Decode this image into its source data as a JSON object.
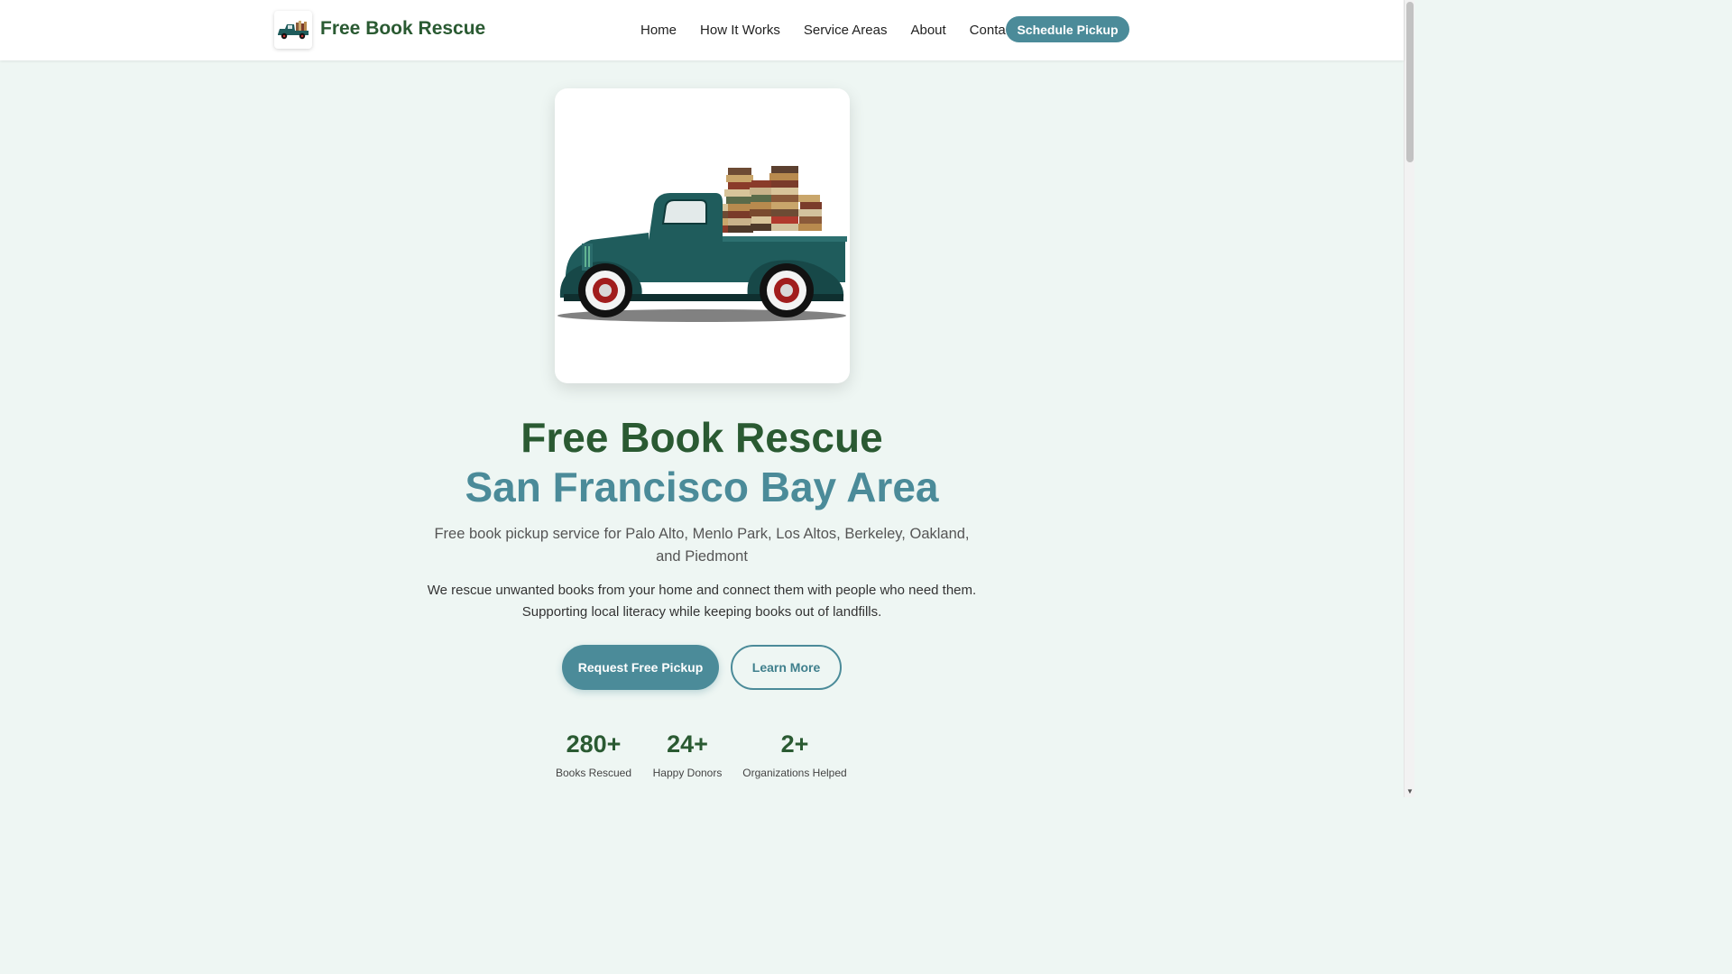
{
  "header": {
    "brand": "Free Book Rescue",
    "logo_icon": "truck-with-books-icon",
    "nav": [
      {
        "label": "Home"
      },
      {
        "label": "How It Works"
      },
      {
        "label": "Service Areas"
      },
      {
        "label": "About"
      },
      {
        "label": "Contact"
      }
    ],
    "cta_label": "Schedule Pickup"
  },
  "hero": {
    "image_icon": "vintage-truck-with-books-image",
    "title": "Free Book Rescue",
    "subtitle": "San Francisco Bay Area",
    "tagline": "Free book pickup service for Palo Alto, Menlo Park, Los Altos, Berkeley, Oakland, and Piedmont",
    "description": "We rescue unwanted books from your home and connect them with people who need them. Supporting local literacy while keeping books out of landfills.",
    "primary_button": "Request Free Pickup",
    "secondary_button": "Learn More"
  },
  "stats": [
    {
      "value": "280+",
      "label": "Books Rescued"
    },
    {
      "value": "24+",
      "label": "Happy Donors"
    },
    {
      "value": "2+",
      "label": "Organizations Helped"
    }
  ],
  "colors": {
    "brand_green": "#2a5a32",
    "accent_teal": "#4b8b99",
    "page_background": "#eef6f3"
  }
}
